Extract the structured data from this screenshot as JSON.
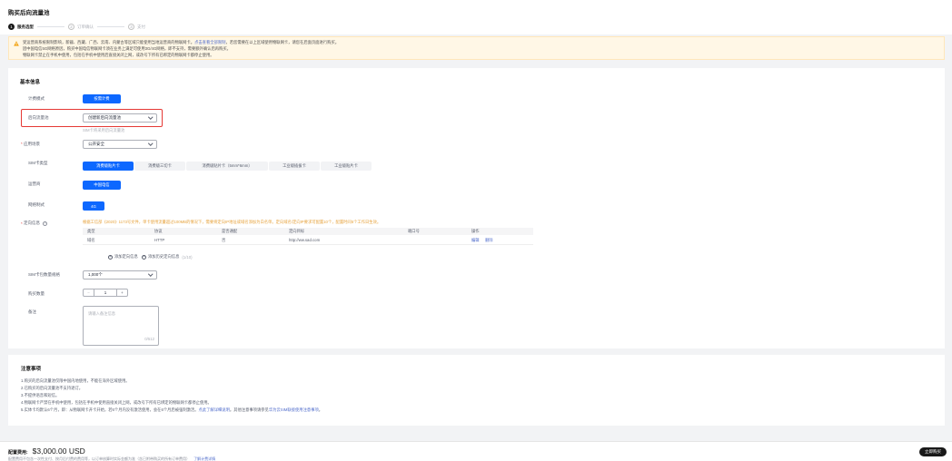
{
  "header": {
    "title": "购买后向流量池",
    "steps": [
      {
        "num": "1",
        "label": "服务选型",
        "active": true
      },
      {
        "num": "2",
        "label": "订单确认",
        "active": false
      },
      {
        "num": "3",
        "label": "支付",
        "active": false
      }
    ]
  },
  "notice": {
    "line1_pre": "受运营商系统限制影响，新疆、西藏、广西、云南、内蒙古等区域只能使用当地运营商的物联网卡。",
    "line1_link": "点击查看全部限制",
    "line1_post": "，若您需要在以上区域使用物联网卡，请您在后面页面进行购买。",
    "line2": "因中国电信5G网络原因，购买中国电信物联网卡须在业务上满足可使用3G/4G网络，即不支持，需要额外确认后再购买。",
    "line3": "物联网卡禁止在手机中使用，包括在手机中使用后直接关闭上网，或改号下所有已绑定的物联网卡都停止使用。"
  },
  "basic": {
    "section_title": "基本信息",
    "billing_label": "计费模式",
    "billing_value": "按需计费",
    "pool_label": "后向流量池",
    "pool_value": "创建新后向流量池",
    "pool_hint": "SIM卡将采用后向流量池",
    "scene_label": "应用场景",
    "scene_value": "公开安全",
    "sim_type_label": "SIM卡类型",
    "sim_types": [
      "消费级贴片卡",
      "消费级三切卡",
      "消费级贴片卡（5mm*6mm）",
      "工业级插拔卡",
      "工业级贴片卡"
    ],
    "operator_label": "运营商",
    "operator_value": "中国电信",
    "network_label": "网络制式",
    "network_value": "4G",
    "direction_label": "定向信息",
    "direction_tip": "根据工信部《2020》1173号文件，单卡使用流量超过100MB的情况下，需要将定向IP地址或域名添加为白名单。定向域名/定向IP要求可配置10个，配置时间5个工作日生效。",
    "table_headers": [
      "类型",
      "协议",
      "是否通配",
      "定向目标",
      "端口号",
      "操作"
    ],
    "table_row": {
      "type": "域名",
      "protocol": "HTTP",
      "wildcard": "否",
      "target": "http://ww.sad.com",
      "port": "",
      "edit": "编辑",
      "delete": "删除"
    },
    "add_direction": "添加定向信息",
    "add_history": "添加历史定向信息",
    "add_count": "(1/10)",
    "spec_label": "SIM卡包数量规格",
    "spec_value": "1,000个",
    "qty_label": "购买数量",
    "qty_value": "1",
    "qty_minus": "−",
    "qty_plus": "+",
    "remark_label": "备注",
    "remark_placeholder": "请输入备注信息",
    "remark_count": "0/512"
  },
  "notes": {
    "title": "注意事项",
    "items": [
      "1.购买的后向流量池仅限中国内地使用，不能在海外区域使用。",
      "2.已购买的后向流量池不支持退订。",
      "3.不提供语音和短信。",
      "4.物联网卡严禁在手机中使用，包括在手机中使用直接关闭上网，或改号下所有已绑定的物联网卡都停止使用。"
    ],
    "item5_pre": "5.实体卡均默认6个月，即：从物联网卡开卡开始，若6个月内没有激活使用，会在6个月后被强制激活。",
    "item5_link1": "点此了解详细说明",
    "item5_mid": "。其他注意事项请参见",
    "item5_link2": "华为云SIM联接使用注意事项",
    "item5_end": "。"
  },
  "footer": {
    "fee_label": "配置费用:",
    "fee_value": "$3,000.00 USD",
    "fee_note": "配置费用不包含一次性支付、按月后付费的费用等，以订单核算时实际金额为准（含已附带购买的所有订单费用）",
    "fee_link": "了解计费详情",
    "buy_label": "立即购买"
  },
  "colors": {
    "primary": "#0d68ff",
    "highlight_border": "#e53935",
    "warning": "#e6a23c",
    "link": "#526ecc"
  }
}
